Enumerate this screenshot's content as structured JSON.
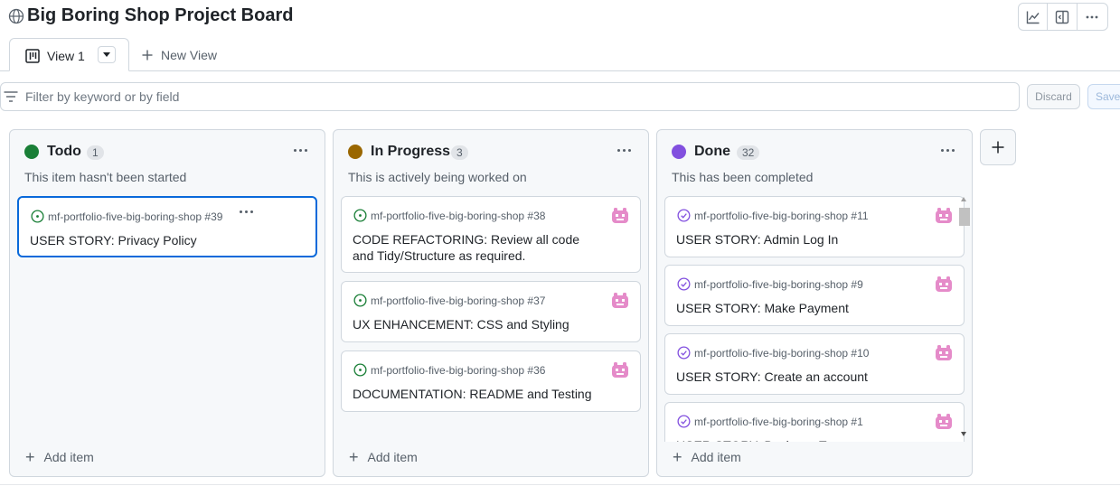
{
  "page": {
    "title": "Big Boring Shop Project Board"
  },
  "toolbar": {
    "icons": [
      "insights-icon",
      "side-panel-icon",
      "more-options-icon"
    ]
  },
  "tabs": {
    "active_label": "View 1",
    "new_view_label": "New View"
  },
  "filter": {
    "placeholder": "Filter by keyword or by field",
    "discard_label": "Discard",
    "save_label": "Save"
  },
  "colors": {
    "todo": "#1a7f37",
    "in_progress": "#9a6700",
    "done": "#8250df",
    "accent": "#0969da"
  },
  "columns": [
    {
      "name": "Todo",
      "count": "1",
      "description": "This item hasn't been started",
      "add_label": "Add item",
      "cards": [
        {
          "repo": "mf-portfolio-five-big-boring-shop #39",
          "title": "USER STORY: Privacy Policy"
        }
      ]
    },
    {
      "name": "In Progress",
      "count": "3",
      "description": "This is actively being worked on",
      "add_label": "Add item",
      "cards": [
        {
          "repo": "mf-portfolio-five-big-boring-shop #38",
          "title": "CODE REFACTORING: Review all code and Tidy/Structure as required."
        },
        {
          "repo": "mf-portfolio-five-big-boring-shop #37",
          "title": "UX ENHANCEMENT: CSS and Styling"
        },
        {
          "repo": "mf-portfolio-five-big-boring-shop #36",
          "title": "DOCUMENTATION: README and Testing"
        }
      ]
    },
    {
      "name": "Done",
      "count": "32",
      "description": "This has been completed",
      "add_label": "Add item",
      "cards": [
        {
          "repo": "mf-portfolio-five-big-boring-shop #11",
          "title": "USER STORY: Admin Log In"
        },
        {
          "repo": "mf-portfolio-five-big-boring-shop #9",
          "title": "USER STORY: Make Payment"
        },
        {
          "repo": "mf-portfolio-five-big-boring-shop #10",
          "title": "USER STORY: Create an account"
        },
        {
          "repo": "mf-portfolio-five-big-boring-shop #1",
          "title": "USER STORY: Business Team"
        }
      ]
    }
  ]
}
